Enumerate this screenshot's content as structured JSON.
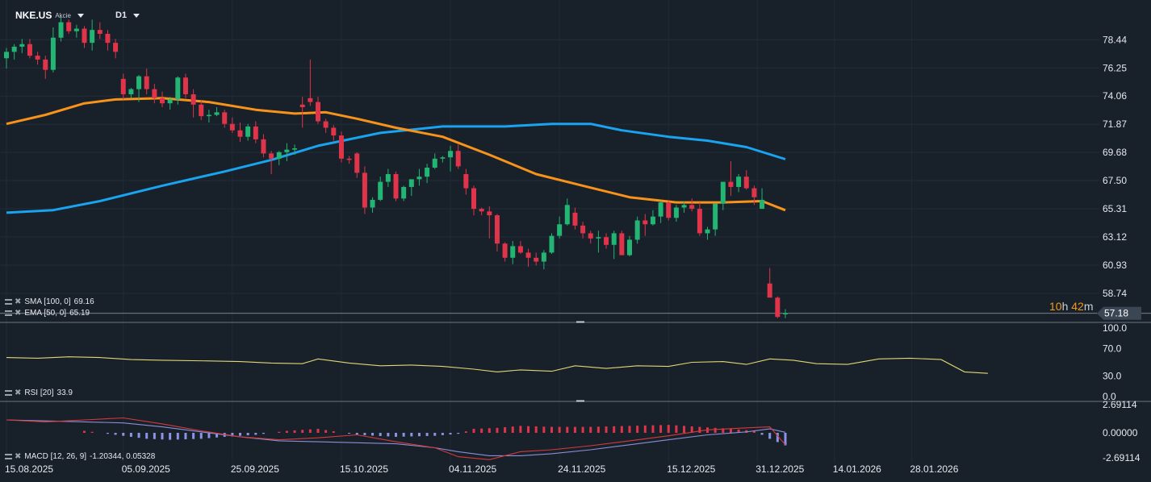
{
  "header": {
    "symbol": "NKE.US",
    "asset_type": "Akcie",
    "timeframe": "D1"
  },
  "indicators": {
    "sma": {
      "label": "SMA [100, 0]",
      "value": "69.16"
    },
    "ema": {
      "label": "EMA [50, 0]",
      "value": "65.19"
    },
    "rsi": {
      "label": "RSI [20]",
      "value": "33.9"
    },
    "macd": {
      "label": "MACD [12, 26, 9]",
      "values": "-1.20344, 0.05328"
    }
  },
  "countdown": {
    "hours": "10",
    "h_unit": "h",
    "minutes": "42",
    "m_unit": "m"
  },
  "current_price": "57.18",
  "colors": {
    "background": "#18202a",
    "up": "#22b573",
    "down": "#e0344a",
    "sma": "#1aa3ef",
    "ema": "#f7931a",
    "rsi": "#e2d675",
    "macd_line": "#d63a3a",
    "signal_line": "#8a8fd6",
    "hist_pos": "#e0344a",
    "hist_neg": "#8a93e6",
    "price_tag": "#3a4654"
  },
  "chart_data": {
    "type": "candlestick",
    "price_axis": {
      "ticks": [
        "78.44",
        "76.25",
        "74.06",
        "71.87",
        "69.68",
        "67.50",
        "65.31",
        "63.12",
        "60.93",
        "58.74"
      ],
      "range": [
        56.6,
        80.4
      ]
    },
    "rsi_axis": {
      "ticks": [
        "100.0",
        "70.0",
        "30.0",
        "0.0"
      ],
      "range": [
        0,
        100
      ]
    },
    "macd_axis": {
      "ticks": [
        "2.69114",
        "0.00000",
        "-2.69114"
      ],
      "range": [
        -3.0,
        3.0
      ]
    },
    "x_tick_labels": [
      "15.08.2025",
      "05.09.2025",
      "25.09.2025",
      "15.10.2025",
      "04.11.2025",
      "24.11.2025",
      "15.12.2025",
      "31.12.2025",
      "14.01.2026",
      "28.01.2026"
    ],
    "x_tick_index": [
      0,
      15,
      29,
      43,
      57,
      71,
      85,
      96.4,
      106.3,
      116.2
    ],
    "candles": [
      [
        77.0,
        77.8,
        76.2,
        77.5
      ],
      [
        77.5,
        78.1,
        76.9,
        77.9
      ],
      [
        77.9,
        78.5,
        77.4,
        78.1
      ],
      [
        78.1,
        78.5,
        77.0,
        77.2
      ],
      [
        77.2,
        77.5,
        76.5,
        76.9
      ],
      [
        76.9,
        77.2,
        75.4,
        76.1
      ],
      [
        76.1,
        79.4,
        75.9,
        78.6
      ],
      [
        78.6,
        80.2,
        78.3,
        79.8
      ],
      [
        79.8,
        80.0,
        78.9,
        79.1
      ],
      [
        79.1,
        79.6,
        78.6,
        79.3
      ],
      [
        79.3,
        79.5,
        77.8,
        78.2
      ],
      [
        78.2,
        80.0,
        77.6,
        79.2
      ],
      [
        79.2,
        79.8,
        78.5,
        78.9
      ],
      [
        78.9,
        79.2,
        77.6,
        78.2
      ],
      [
        78.2,
        78.5,
        77.0,
        77.5
      ],
      [
        75.4,
        75.8,
        73.8,
        74.2
      ],
      [
        74.2,
        74.7,
        73.9,
        74.6
      ],
      [
        74.6,
        75.7,
        73.6,
        75.6
      ],
      [
        75.6,
        76.2,
        74.2,
        74.6
      ],
      [
        74.6,
        75.0,
        73.5,
        73.9
      ],
      [
        73.9,
        74.4,
        73.2,
        73.5
      ],
      [
        73.5,
        74.0,
        73.0,
        73.8
      ],
      [
        73.8,
        75.6,
        73.4,
        75.5
      ],
      [
        75.5,
        75.8,
        73.9,
        74.2
      ],
      [
        74.2,
        74.6,
        72.4,
        73.4
      ],
      [
        73.4,
        73.7,
        72.2,
        72.5
      ],
      [
        72.5,
        73.0,
        72.0,
        72.6
      ],
      [
        72.6,
        73.2,
        72.5,
        72.8
      ],
      [
        72.8,
        73.0,
        71.6,
        71.9
      ],
      [
        71.9,
        72.4,
        71.2,
        71.4
      ],
      [
        71.4,
        72.0,
        70.5,
        70.9
      ],
      [
        70.9,
        71.9,
        70.6,
        71.7
      ],
      [
        71.7,
        72.1,
        70.4,
        70.7
      ],
      [
        70.7,
        71.1,
        69.3,
        69.6
      ],
      [
        69.6,
        69.8,
        68.0,
        69.2
      ],
      [
        69.2,
        69.8,
        68.7,
        69.7
      ],
      [
        69.7,
        70.4,
        69.0,
        69.9
      ],
      [
        69.9,
        70.3,
        69.5,
        70.0
      ],
      [
        73.4,
        74.0,
        71.6,
        73.2
      ],
      [
        73.9,
        76.9,
        73.3,
        73.6
      ],
      [
        73.6,
        74.0,
        71.9,
        72.1
      ],
      [
        72.1,
        72.3,
        71.2,
        71.6
      ],
      [
        71.6,
        71.8,
        70.6,
        71.0
      ],
      [
        71.0,
        71.3,
        68.9,
        69.2
      ],
      [
        69.2,
        69.4,
        68.8,
        69.1
      ],
      [
        69.6,
        69.7,
        67.7,
        68.1
      ],
      [
        68.1,
        68.6,
        64.9,
        65.4
      ],
      [
        65.4,
        66.2,
        65.0,
        66.0
      ],
      [
        66.0,
        67.8,
        65.9,
        67.4
      ],
      [
        67.4,
        68.4,
        67.0,
        68.0
      ],
      [
        68.0,
        68.2,
        65.9,
        66.1
      ],
      [
        66.1,
        67.1,
        65.9,
        67.0
      ],
      [
        67.0,
        67.5,
        66.3,
        67.6
      ],
      [
        67.6,
        68.4,
        67.1,
        67.8
      ],
      [
        67.8,
        68.8,
        67.3,
        68.5
      ],
      [
        68.5,
        69.6,
        68.4,
        69.2
      ],
      [
        69.2,
        69.4,
        68.9,
        69.3
      ],
      [
        69.3,
        70.2,
        68.2,
        69.8
      ],
      [
        69.8,
        70.3,
        68.4,
        68.6
      ],
      [
        68.0,
        68.4,
        66.4,
        66.9
      ],
      [
        66.9,
        67.1,
        64.8,
        65.3
      ],
      [
        65.3,
        65.4,
        64.8,
        65.1
      ],
      [
        65.1,
        65.5,
        63.0,
        64.8
      ],
      [
        64.8,
        64.9,
        62.0,
        62.6
      ],
      [
        62.6,
        62.7,
        61.2,
        61.5
      ],
      [
        61.5,
        62.8,
        61.0,
        62.4
      ],
      [
        62.4,
        62.8,
        61.8,
        61.9
      ],
      [
        61.9,
        62.2,
        60.8,
        61.5
      ],
      [
        61.5,
        61.9,
        60.9,
        61.2
      ],
      [
        61.2,
        62.1,
        60.6,
        61.9
      ],
      [
        61.9,
        63.4,
        61.8,
        63.2
      ],
      [
        63.2,
        64.7,
        63.0,
        64.1
      ],
      [
        64.1,
        66.1,
        64.0,
        65.6
      ],
      [
        65.0,
        65.4,
        63.7,
        64.0
      ],
      [
        64.0,
        64.3,
        63.0,
        63.4
      ],
      [
        63.4,
        63.6,
        62.6,
        63.0
      ],
      [
        63.0,
        63.6,
        61.9,
        63.1
      ],
      [
        63.1,
        63.4,
        62.2,
        62.5
      ],
      [
        62.5,
        63.6,
        61.4,
        63.4
      ],
      [
        63.4,
        63.6,
        61.7,
        61.7
      ],
      [
        61.7,
        63.2,
        61.6,
        62.9
      ],
      [
        62.9,
        64.7,
        62.6,
        64.4
      ],
      [
        64.4,
        64.9,
        63.2,
        64.1
      ],
      [
        64.1,
        65.2,
        64.0,
        64.7
      ],
      [
        64.7,
        65.9,
        64.2,
        65.8
      ],
      [
        65.8,
        65.9,
        64.4,
        64.6
      ],
      [
        64.6,
        65.6,
        64.3,
        65.4
      ],
      [
        65.4,
        65.9,
        65.0,
        65.6
      ],
      [
        65.6,
        66.1,
        65.1,
        65.3
      ],
      [
        65.3,
        65.8,
        63.2,
        63.4
      ],
      [
        63.4,
        63.9,
        62.9,
        63.7
      ],
      [
        63.7,
        64.6,
        63.2,
        65.7
      ],
      [
        65.7,
        67.4,
        65.2,
        67.4
      ],
      [
        67.4,
        69.0,
        66.3,
        67.0
      ],
      [
        67.0,
        68.0,
        66.6,
        67.8
      ],
      [
        67.8,
        68.3,
        66.8,
        66.9
      ],
      [
        66.9,
        67.1,
        65.6,
        66.2
      ],
      [
        65.3,
        66.9,
        65.4,
        66.0
      ],
      [
        59.5,
        60.7,
        58.5,
        58.4
      ],
      [
        58.4,
        58.5,
        56.8,
        56.9
      ],
      [
        57.1,
        57.5,
        56.8,
        57.2
      ]
    ],
    "sma100": [
      [
        0,
        65.0
      ],
      [
        6,
        65.2
      ],
      [
        12,
        65.9
      ],
      [
        20,
        67.1
      ],
      [
        28,
        68.2
      ],
      [
        34,
        69.1
      ],
      [
        40,
        70.2
      ],
      [
        48,
        71.2
      ],
      [
        56,
        71.7
      ],
      [
        64,
        71.7
      ],
      [
        70,
        71.9
      ],
      [
        75,
        71.9
      ],
      [
        79,
        71.4
      ],
      [
        85,
        70.9
      ],
      [
        90,
        70.6
      ],
      [
        95,
        70.1
      ],
      [
        100,
        69.16
      ]
    ],
    "ema50": [
      [
        0,
        71.9
      ],
      [
        5,
        72.6
      ],
      [
        10,
        73.5
      ],
      [
        14,
        73.8
      ],
      [
        20,
        73.9
      ],
      [
        26,
        73.6
      ],
      [
        32,
        73.0
      ],
      [
        37,
        72.7
      ],
      [
        41,
        72.8
      ],
      [
        45,
        72.3
      ],
      [
        50,
        71.6
      ],
      [
        56,
        70.9
      ],
      [
        62,
        69.5
      ],
      [
        68,
        68.0
      ],
      [
        74,
        67.1
      ],
      [
        80,
        66.2
      ],
      [
        86,
        65.8
      ],
      [
        92,
        65.8
      ],
      [
        97,
        65.9
      ],
      [
        100,
        65.19
      ]
    ],
    "rsi": [
      [
        0,
        57
      ],
      [
        4,
        56
      ],
      [
        8,
        58
      ],
      [
        12,
        57
      ],
      [
        16,
        54
      ],
      [
        20,
        53
      ],
      [
        26,
        52
      ],
      [
        30,
        51
      ],
      [
        34,
        49
      ],
      [
        38,
        48
      ],
      [
        40,
        55
      ],
      [
        44,
        49
      ],
      [
        48,
        45
      ],
      [
        52,
        46
      ],
      [
        56,
        44
      ],
      [
        60,
        40
      ],
      [
        63,
        36
      ],
      [
        66,
        39
      ],
      [
        70,
        37
      ],
      [
        73,
        45
      ],
      [
        77,
        41
      ],
      [
        81,
        45
      ],
      [
        85,
        44
      ],
      [
        88,
        50
      ],
      [
        92,
        51
      ],
      [
        95,
        47
      ],
      [
        98,
        55
      ],
      [
        101,
        53
      ],
      [
        104,
        48
      ],
      [
        108,
        47
      ],
      [
        112,
        55
      ],
      [
        116,
        56
      ],
      [
        120,
        54
      ],
      [
        123,
        36
      ],
      [
        126,
        33.9
      ]
    ],
    "macd": [
      [
        0,
        1.3
      ],
      [
        5,
        1.1
      ],
      [
        10,
        1.3
      ],
      [
        15,
        1.5
      ],
      [
        20,
        0.9
      ],
      [
        25,
        0.2
      ],
      [
        30,
        -0.4
      ],
      [
        35,
        -0.7
      ],
      [
        40,
        -0.5
      ],
      [
        45,
        -0.2
      ],
      [
        50,
        -0.9
      ],
      [
        55,
        -1.5
      ],
      [
        58,
        -2.4
      ],
      [
        62,
        -2.7
      ],
      [
        66,
        -1.9
      ],
      [
        70,
        -1.7
      ],
      [
        75,
        -1.3
      ],
      [
        80,
        -0.8
      ],
      [
        85,
        -0.3
      ],
      [
        90,
        0.3
      ],
      [
        95,
        0.5
      ],
      [
        98,
        0.6
      ],
      [
        100,
        -1.20344
      ]
    ],
    "signal": [
      [
        0,
        1.3
      ],
      [
        5,
        1.2
      ],
      [
        10,
        1.1
      ],
      [
        15,
        1.0
      ],
      [
        20,
        0.6
      ],
      [
        25,
        0.1
      ],
      [
        30,
        -0.4
      ],
      [
        35,
        -0.8
      ],
      [
        40,
        -0.9
      ],
      [
        45,
        -1.0
      ],
      [
        50,
        -1.1
      ],
      [
        55,
        -1.5
      ],
      [
        58,
        -1.9
      ],
      [
        62,
        -2.3
      ],
      [
        66,
        -2.3
      ],
      [
        70,
        -2.1
      ],
      [
        75,
        -1.7
      ],
      [
        80,
        -1.2
      ],
      [
        85,
        -0.7
      ],
      [
        90,
        -0.2
      ],
      [
        95,
        0.1
      ],
      [
        98,
        0.4
      ],
      [
        100,
        0.05328
      ]
    ],
    "macd_hist": [
      [
        0,
        0.0
      ],
      [
        10,
        0.2
      ],
      [
        15,
        -0.3
      ],
      [
        18,
        -0.6
      ],
      [
        21,
        -0.7
      ],
      [
        25,
        -0.6
      ],
      [
        28,
        -0.4
      ],
      [
        32,
        -0.2
      ],
      [
        36,
        0.2
      ],
      [
        40,
        0.4
      ],
      [
        45,
        -0.2
      ],
      [
        50,
        -0.4
      ],
      [
        55,
        -0.3
      ],
      [
        58,
        -0.1
      ],
      [
        60,
        0.4
      ],
      [
        63,
        0.5
      ],
      [
        66,
        0.7
      ],
      [
        70,
        0.6
      ],
      [
        75,
        0.6
      ],
      [
        80,
        0.7
      ],
      [
        85,
        0.8
      ],
      [
        89,
        0.6
      ],
      [
        93,
        0.4
      ],
      [
        96,
        0.2
      ],
      [
        98,
        -0.6
      ],
      [
        100,
        -1.26
      ]
    ]
  }
}
